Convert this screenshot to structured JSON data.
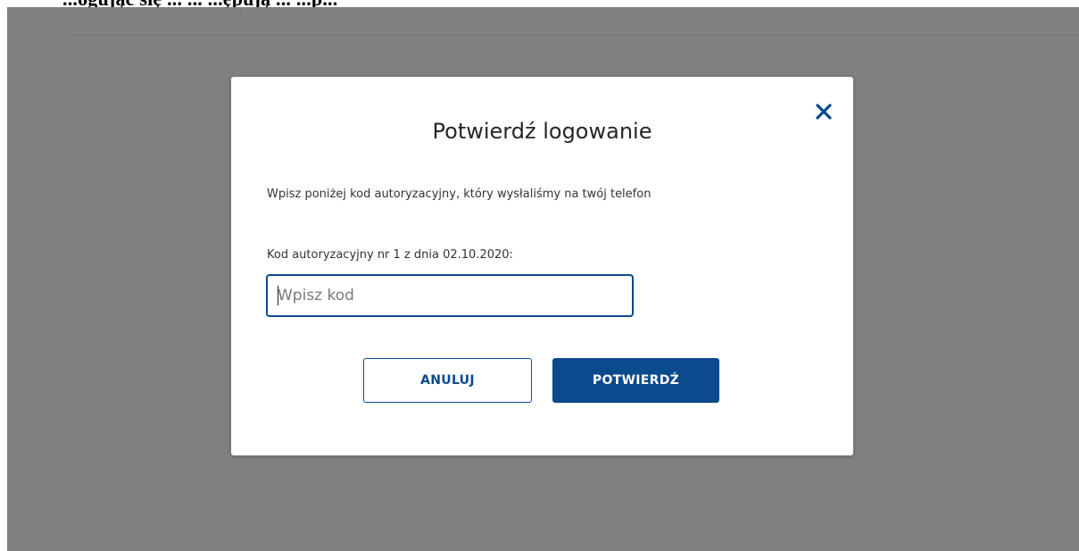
{
  "page_header": {
    "text": "...ogując się ... ... ...ępują ... ...p..."
  },
  "modal": {
    "title": "Potwierdź logowanie",
    "description": "Wpisz poniżej kod autoryzacyjny, który wysłaliśmy na twój telefon",
    "field_label": "Kod autoryzacyjny nr 1 z dnia 02.10.2020:",
    "input": {
      "value": "",
      "placeholder": "Wpisz kod"
    },
    "buttons": {
      "cancel_label": "ANULUJ",
      "confirm_label": "POTWIERDŹ"
    },
    "close_icon": "close-icon"
  },
  "colors": {
    "accent": "#0b4a8c",
    "overlay": "#808080",
    "modal_background": "#ffffff"
  }
}
